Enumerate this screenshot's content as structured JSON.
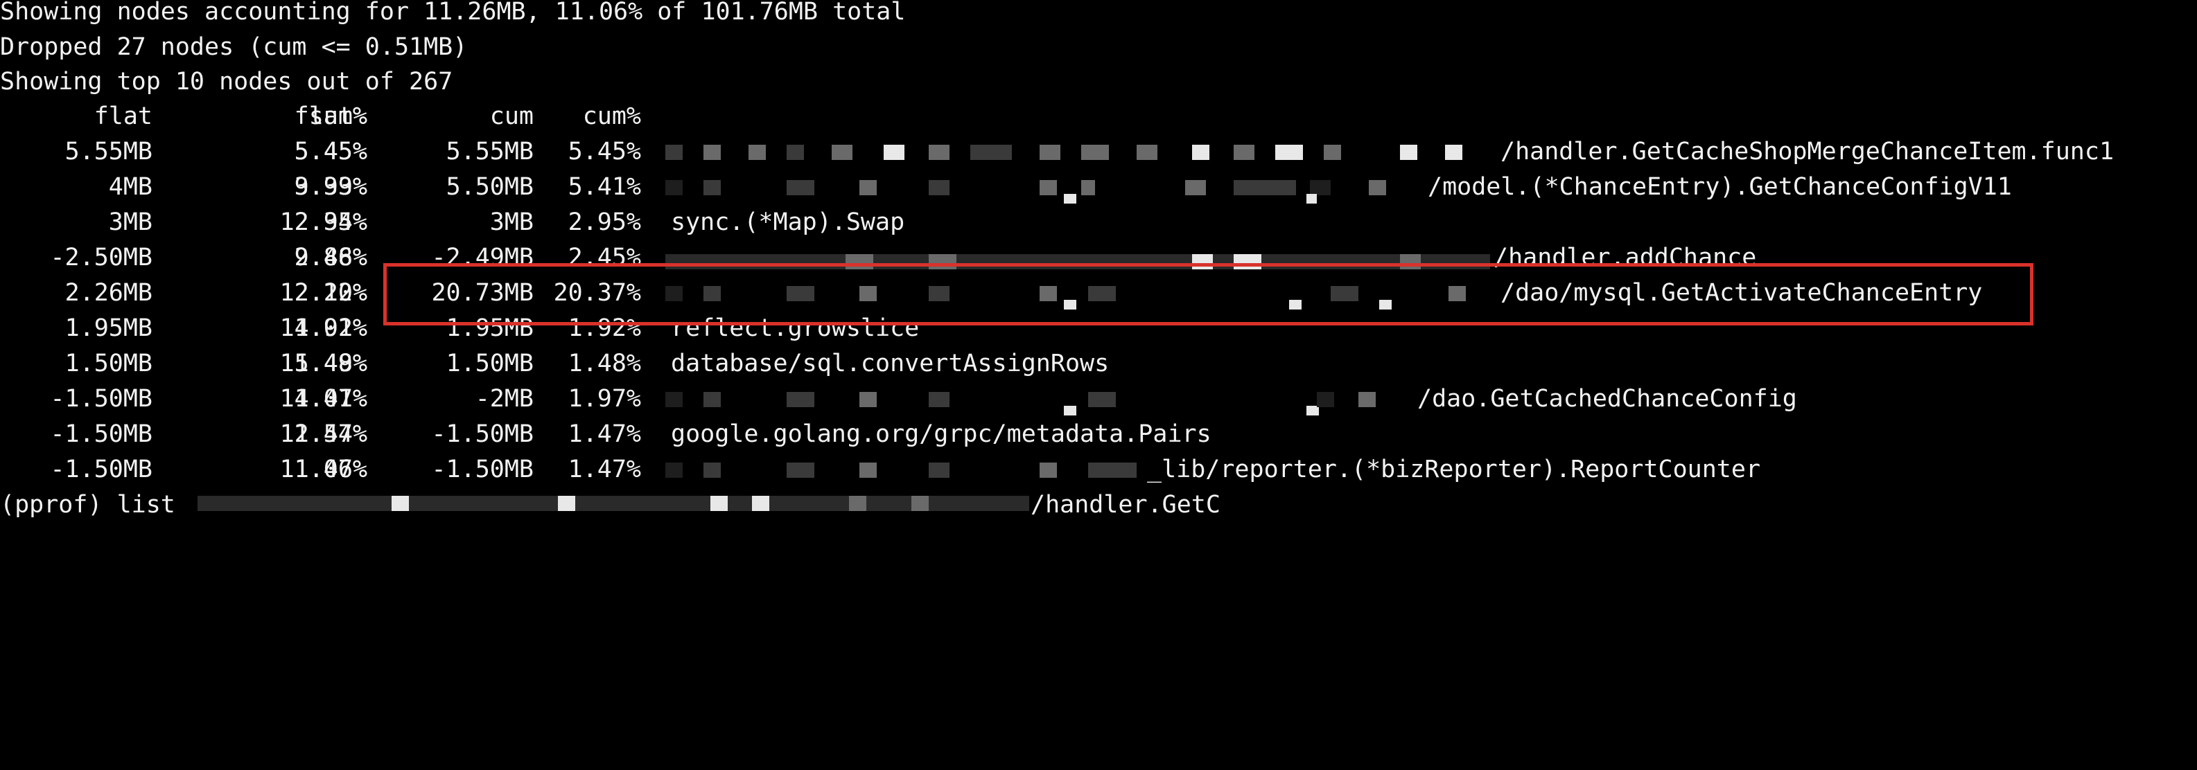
{
  "summary": {
    "line1": "Showing nodes accounting for 11.26MB, 11.06% of 101.76MB total",
    "line2": "Dropped 27 nodes (cum <= 0.51MB)",
    "line3": "Showing top 10 nodes out of 267"
  },
  "table": {
    "headers": [
      "flat",
      "flat%",
      "sum%",
      "cum",
      "cum%"
    ],
    "rows": [
      {
        "flat": "5.55MB",
        "flat_pct": "5.45%",
        "sum_pct": "5.45%",
        "cum": "5.55MB",
        "cum_pct": "5.45%",
        "func": "/handler.GetCacheShopMergeChanceItem.func1"
      },
      {
        "flat": "4MB",
        "flat_pct": "3.93%",
        "sum_pct": "9.39%",
        "cum": "5.50MB",
        "cum_pct": "5.41%",
        "func": "/model.(*ChanceEntry).GetChanceConfigV11"
      },
      {
        "flat": "3MB",
        "flat_pct": "2.95%",
        "sum_pct": "12.34%",
        "cum": "3MB",
        "cum_pct": "2.95%",
        "func": "sync.(*Map).Swap"
      },
      {
        "flat": "-2.50MB",
        "flat_pct": "2.46%",
        "sum_pct": "9.88%",
        "cum": "-2.49MB",
        "cum_pct": "2.45%",
        "func": "/handler.addChance"
      },
      {
        "flat": "2.26MB",
        "flat_pct": "2.22%",
        "sum_pct": "12.10%",
        "cum": "20.73MB",
        "cum_pct": "20.37%",
        "func": "/dao/mysql.GetActivateChanceEntry"
      },
      {
        "flat": "1.95MB",
        "flat_pct": "1.92%",
        "sum_pct": "14.01%",
        "cum": "1.95MB",
        "cum_pct": "1.92%",
        "func": "reflect.growslice"
      },
      {
        "flat": "1.50MB",
        "flat_pct": "1.48%",
        "sum_pct": "15.49%",
        "cum": "1.50MB",
        "cum_pct": "1.48%",
        "func": "database/sql.convertAssignRows"
      },
      {
        "flat": "-1.50MB",
        "flat_pct": "1.47%",
        "sum_pct": "14.01%",
        "cum": "-2MB",
        "cum_pct": "1.97%",
        "func": "/dao.GetCachedChanceConfig"
      },
      {
        "flat": "-1.50MB",
        "flat_pct": "1.47%",
        "sum_pct": "12.54%",
        "cum": "-1.50MB",
        "cum_pct": "1.47%",
        "func": "google.golang.org/grpc/metadata.Pairs"
      },
      {
        "flat": "-1.50MB",
        "flat_pct": "1.47%",
        "sum_pct": "11.06%",
        "cum": "-1.50MB",
        "cum_pct": "1.47%",
        "func": "_lib/reporter.(*bizReporter).ReportCounter"
      }
    ]
  },
  "prompt": {
    "prefix": "(pprof) list ",
    "suffix": "/handler.GetC"
  },
  "colors": {
    "background": "#000000",
    "text": "#f2f2f2",
    "highlight_border": "#d9322b"
  }
}
